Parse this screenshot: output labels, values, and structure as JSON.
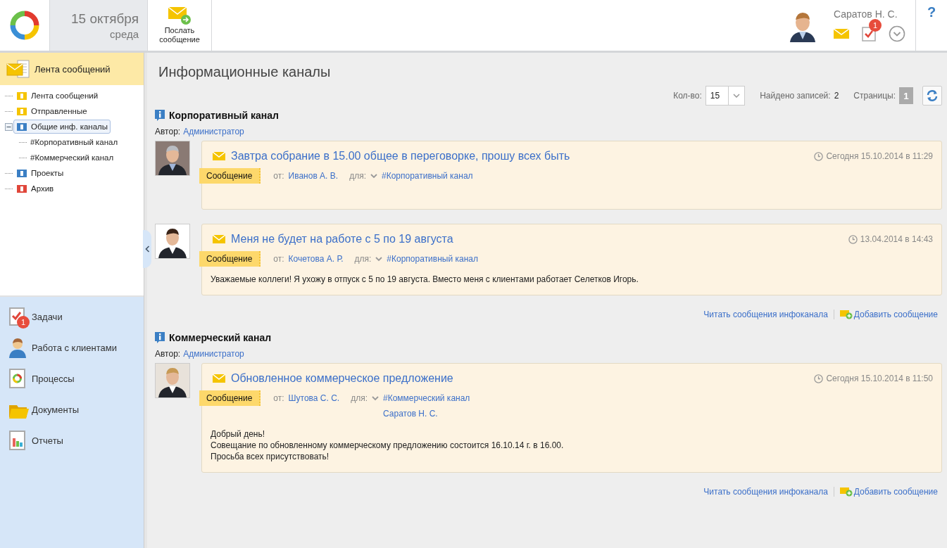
{
  "header": {
    "date": "15 октября",
    "weekday": "среда",
    "send_button": "Послать сообщение",
    "user_name": "Саратов Н. С.",
    "tasks_badge": "1",
    "help": "?"
  },
  "sidebar": {
    "title": "Лента сообщений",
    "tree": [
      {
        "label": "Лента сообщений",
        "selected": false
      },
      {
        "label": "Отправленные",
        "selected": false
      },
      {
        "label": "Общие инф. каналы",
        "selected": true,
        "expanded": true,
        "children": [
          {
            "label": "#Корпоративный канал",
            "selected": false
          },
          {
            "label": "#Коммерческий канал",
            "selected": false
          }
        ]
      },
      {
        "label": "Проекты",
        "selected": false
      },
      {
        "label": "Архив",
        "selected": false
      }
    ],
    "nav": [
      {
        "label": "Задачи",
        "badge": "1"
      },
      {
        "label": "Работа с клиентами"
      },
      {
        "label": "Процессы"
      },
      {
        "label": "Документы"
      },
      {
        "label": "Отчеты"
      }
    ]
  },
  "main": {
    "title": "Информационные каналы",
    "pager": {
      "count_label": "Кол-во:",
      "count": "15",
      "found_label": "Найдено записей:",
      "found": "2",
      "pages_label": "Страницы:",
      "page": "1"
    },
    "channels": [
      {
        "title": "Корпоративный канал",
        "author_label": "Автор:",
        "author": "Администратор",
        "messages": [
          {
            "title": "Завтра собрание в 15.00 общее в переговорке, прошу всех быть",
            "time": "Сегодня 15.10.2014 в 11:29",
            "tag": "Сообщение",
            "from_label": "от:",
            "from": "Иванов А. В.",
            "to_label": "для:",
            "recipients": [
              "#Корпоративный канал"
            ]
          },
          {
            "title": "Меня не будет на работе с 5 по 19 августа",
            "time": "13.04.2014 в 14:43",
            "tag": "Сообщение",
            "from_label": "от:",
            "from": "Кочетова А. Р.",
            "to_label": "для:",
            "recipients": [
              "#Корпоративный канал"
            ],
            "body": [
              "Уважаемые коллеги! Я ухожу в отпуск с 5 по 19 августа. Вместо меня с клиентами работает Селетков Игорь."
            ]
          }
        ],
        "read_link": "Читать сообщения инфоканала",
        "add_link": "Добавить сообщение"
      },
      {
        "title": "Коммерческий канал",
        "author_label": "Автор:",
        "author": "Администратор",
        "messages": [
          {
            "title": "Обновленное коммерческое предложение",
            "time": "Сегодня 15.10.2014 в 11:50",
            "tag": "Сообщение",
            "from_label": "от:",
            "from": "Шутова С. С.",
            "to_label": "для:",
            "recipients": [
              "#Коммерческий канал",
              "Саратов Н. С."
            ],
            "body": [
              "Добрый день!",
              "Совещание по обновленному коммерческому предложению состоится 16.10.14 г. в 16.00.",
              "Просьба всех присутствовать!"
            ]
          }
        ],
        "read_link": "Читать сообщения инфоканала",
        "add_link": "Добавить сообщение"
      }
    ]
  }
}
